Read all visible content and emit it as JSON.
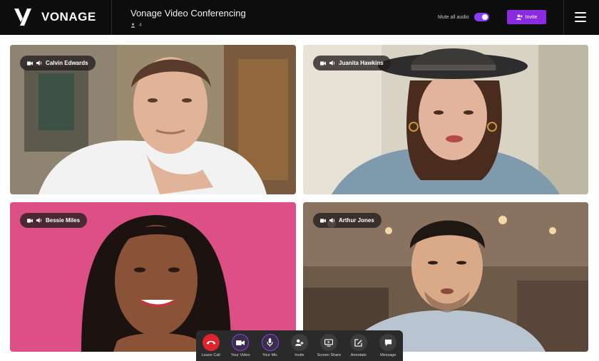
{
  "header": {
    "brand": "VONAGE",
    "meeting_title": "Vonage Video Conferencing",
    "participant_count": "4",
    "mute_all_label": "Mute all audio",
    "mute_all_enabled": true,
    "invite_label": "Invite",
    "accent_color": "#8a2be2"
  },
  "participants": [
    {
      "name": "Calvin Edwards",
      "camera_icon": "camera-icon",
      "audio_icon": "speaker-icon"
    },
    {
      "name": "Juanita Hawkins",
      "camera_icon": "camera-icon",
      "audio_icon": "speaker-icon"
    },
    {
      "name": "Bessie Miles",
      "camera_icon": "camera-icon",
      "audio_icon": "speaker-icon"
    },
    {
      "name": "Arthur Jones",
      "camera_icon": "camera-icon",
      "audio_icon": "speaker-icon"
    }
  ],
  "controls": [
    {
      "label": "Leave Call",
      "icon": "phone-hangup-icon",
      "color": "#e0242e"
    },
    {
      "label": "Your Video",
      "icon": "video-camera-icon"
    },
    {
      "label": "Your Mic",
      "icon": "microphone-icon"
    },
    {
      "label": "Invite",
      "icon": "add-person-icon"
    },
    {
      "label": "Screen Share",
      "icon": "screen-share-icon"
    },
    {
      "label": "Annotate",
      "icon": "annotate-icon"
    },
    {
      "label": "Message",
      "icon": "message-icon"
    }
  ]
}
